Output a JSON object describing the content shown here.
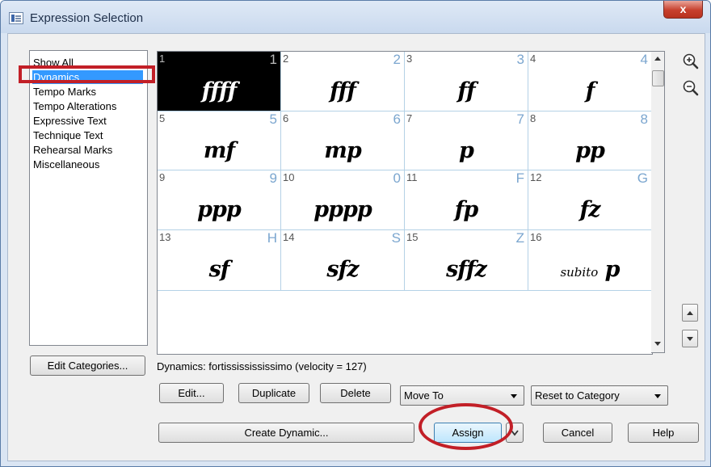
{
  "window": {
    "title": "Expression Selection",
    "close_label": "x"
  },
  "categories": [
    {
      "label": "Show All"
    },
    {
      "label": "Dynamics",
      "selected": true
    },
    {
      "label": "Tempo Marks"
    },
    {
      "label": "Tempo Alterations"
    },
    {
      "label": "Expressive Text"
    },
    {
      "label": "Technique Text"
    },
    {
      "label": "Rehearsal Marks"
    },
    {
      "label": "Miscellaneous"
    }
  ],
  "edit_categories_label": "Edit Categories...",
  "expressions": [
    {
      "num": "1",
      "key": "1",
      "symbol": "ffff",
      "selected": true
    },
    {
      "num": "2",
      "key": "2",
      "symbol": "fff"
    },
    {
      "num": "3",
      "key": "3",
      "symbol": "ff"
    },
    {
      "num": "4",
      "key": "4",
      "symbol": "f"
    },
    {
      "num": "5",
      "key": "5",
      "symbol": "mf"
    },
    {
      "num": "6",
      "key": "6",
      "symbol": "mp"
    },
    {
      "num": "7",
      "key": "7",
      "symbol": "p"
    },
    {
      "num": "8",
      "key": "8",
      "symbol": "pp"
    },
    {
      "num": "9",
      "key": "9",
      "symbol": "ppp"
    },
    {
      "num": "10",
      "key": "0",
      "symbol": "pppp"
    },
    {
      "num": "11",
      "key": "F",
      "symbol": "fp"
    },
    {
      "num": "12",
      "key": "G",
      "symbol": "fz"
    },
    {
      "num": "13",
      "key": "H",
      "symbol": "sf"
    },
    {
      "num": "14",
      "key": "S",
      "symbol": "sfz"
    },
    {
      "num": "15",
      "key": "Z",
      "symbol": "sffz"
    },
    {
      "num": "16",
      "key": "",
      "symbol_prefix": "subito",
      "symbol": "p"
    }
  ],
  "status_text": "Dynamics: fortississississimo (velocity = 127)",
  "buttons": {
    "edit": "Edit...",
    "duplicate": "Duplicate",
    "delete": "Delete",
    "create_dynamic": "Create Dynamic...",
    "assign": "Assign",
    "cancel": "Cancel",
    "help": "Help"
  },
  "dropdowns": {
    "move_to": "Move To",
    "reset_to_category": "Reset to Category"
  },
  "icons": {
    "zoom_in": "zoom-in-icon",
    "zoom_out": "zoom-out-icon"
  },
  "colors": {
    "selection": "#3399ff",
    "highlight_red": "#c21f27",
    "key_blue": "#7ba6cf"
  }
}
